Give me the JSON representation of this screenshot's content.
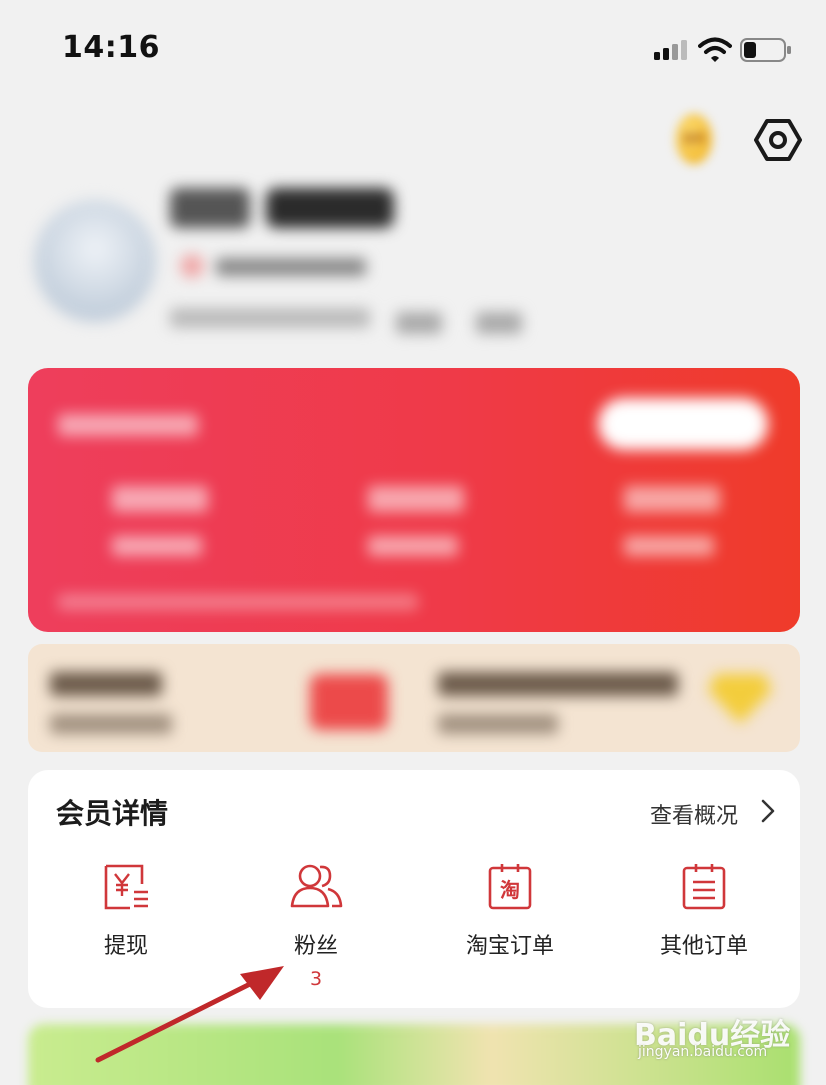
{
  "status_bar": {
    "time": "14:16"
  },
  "header": {
    "checkin_coin_text": "签到"
  },
  "member_card": {
    "title": "会员详情",
    "view_overview": "查看概况",
    "items": [
      {
        "label": "提现",
        "icon": "withdraw-yen-icon"
      },
      {
        "label": "粉丝",
        "icon": "fans-people-icon",
        "count": "3"
      },
      {
        "label": "淘宝订单",
        "icon": "taobao-order-icon"
      },
      {
        "label": "其他订单",
        "icon": "other-order-icon"
      }
    ]
  },
  "colors": {
    "accent_red": "#d0373a",
    "earn_card_start": "#ee3e5c",
    "earn_card_end": "#ef3b2a",
    "annotation_arrow": "#c0282a"
  },
  "watermark": {
    "brand": "Baidu经验",
    "url": "jingyan.baidu.com"
  }
}
